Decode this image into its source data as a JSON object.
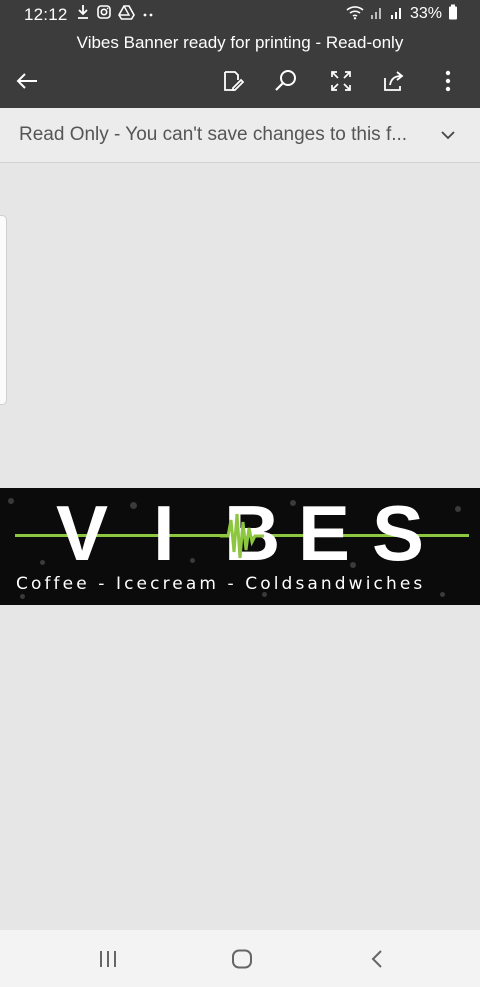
{
  "status_bar": {
    "time": "12:12",
    "battery_percent": "33%",
    "left_icons": [
      "download-icon",
      "instagram-icon",
      "drive-icon",
      "more-dots-icon"
    ],
    "right_icons": [
      "wifi-icon",
      "signal-icon",
      "signal-icon",
      "battery-icon"
    ]
  },
  "title_bar": {
    "title": "Vibes Banner ready for printing - Read-only",
    "icons": [
      "back-arrow-icon",
      "edit-icon",
      "search-icon",
      "fullscreen-icon",
      "share-icon",
      "overflow-menu-icon"
    ]
  },
  "info_bar": {
    "message": "Read Only - You can't save changes to this f..."
  },
  "document": {
    "artwork": {
      "letters": [
        "V",
        "I",
        "B",
        "E",
        "S"
      ],
      "tagline": "Coffee - Icecream - Coldsandwiches",
      "accent_color": "#8dc63f",
      "background_color": "#0b0b0b"
    }
  },
  "nav_bar": {
    "icons": [
      "recents-icon",
      "home-icon",
      "back-icon"
    ]
  },
  "colors": {
    "toolbar": "#3c3c3c",
    "canvas": "#e6e6e6",
    "info_bar": "#ececec"
  }
}
